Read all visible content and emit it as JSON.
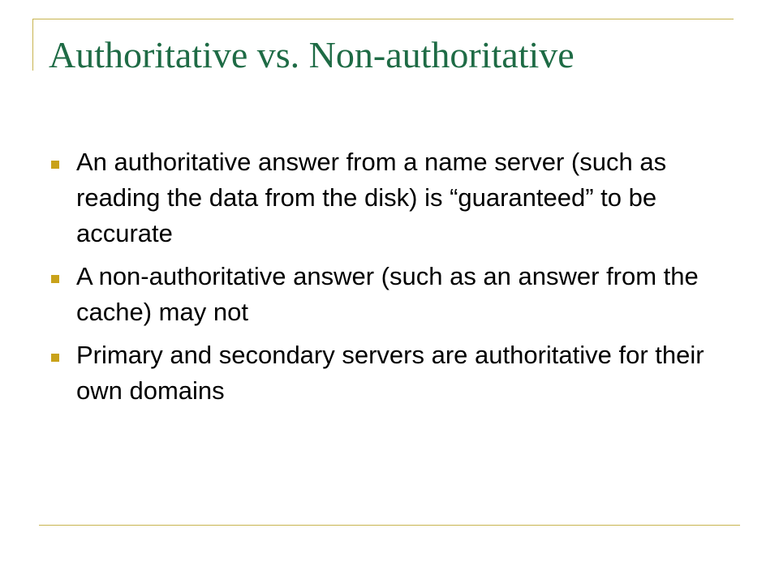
{
  "slide": {
    "title": "Authoritative vs. Non-authoritative",
    "bullets": [
      {
        "text": "An authoritative answer from a name server (such as reading the data from the disk) is “guaranteed” to be accurate"
      },
      {
        "text": "A non-authoritative answer (such as an answer from the cache) may not"
      },
      {
        "text": "Primary and secondary servers are authoritative for their own domains"
      }
    ]
  },
  "colors": {
    "title": "#1e6b45",
    "accent_rule": "#c8b450",
    "bullet_marker": "#c9a21a",
    "body_text": "#000000",
    "background": "#ffffff"
  },
  "icons": {
    "bullet": "square-bullet-icon"
  }
}
